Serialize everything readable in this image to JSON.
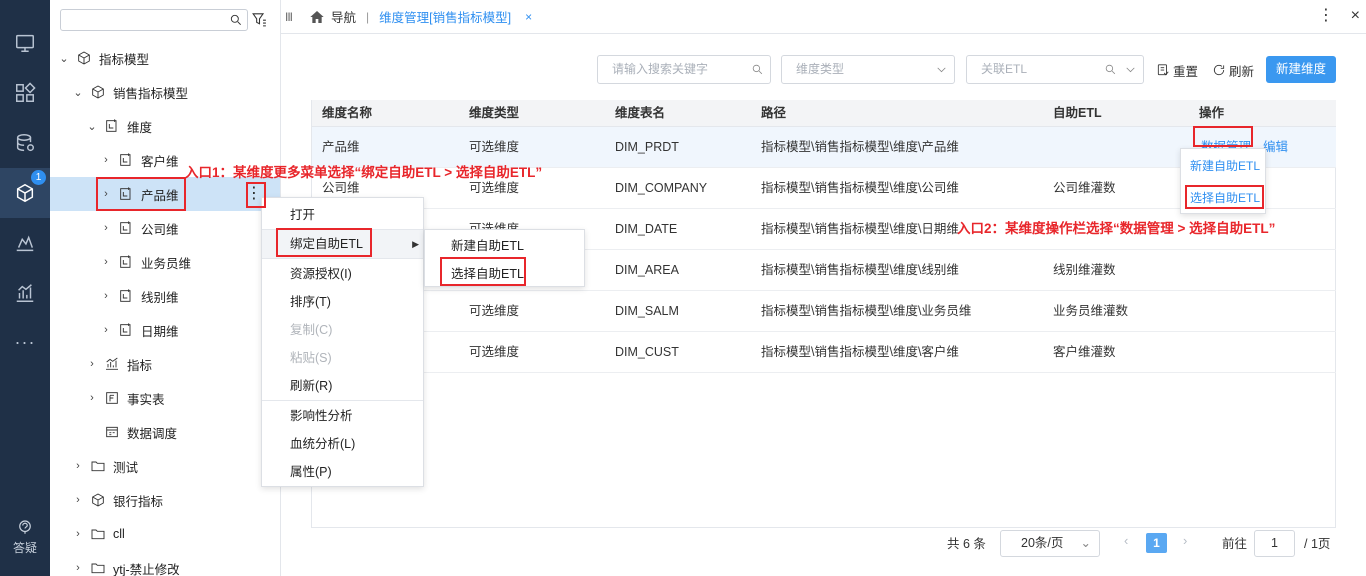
{
  "topbar": {
    "nav_label": "导航",
    "separator": "|",
    "active_tab": "维度管理[销售指标模型]",
    "tab_close": "×",
    "more": "⋮",
    "close": "×"
  },
  "rail": {
    "badge": "1",
    "more_label": "···",
    "help_label": "答疑",
    "icons": [
      "monitor-icon",
      "apps-icon",
      "database-gear-icon",
      "cube-icon",
      "chart-icon",
      "bar-chart-icon"
    ]
  },
  "tree": {
    "search_placeholder": "",
    "items": [
      {
        "label": "指标模型",
        "arrow": "⌄",
        "icon": "cube-icon"
      },
      {
        "label": "销售指标模型",
        "arrow": "⌄",
        "icon": "cube-icon"
      },
      {
        "label": "维度",
        "arrow": "⌄",
        "icon": "dimension-icon"
      },
      {
        "label": "客户维",
        "arrow": "›",
        "icon": "dimension-icon"
      },
      {
        "label": "产品维",
        "arrow": "›",
        "icon": "dimension-icon"
      },
      {
        "label": "公司维",
        "arrow": "›",
        "icon": "dimension-icon"
      },
      {
        "label": "业务员维",
        "arrow": "›",
        "icon": "dimension-icon"
      },
      {
        "label": "线别维",
        "arrow": "›",
        "icon": "dimension-icon"
      },
      {
        "label": "日期维",
        "arrow": "›",
        "icon": "dimension-icon"
      },
      {
        "label": "指标",
        "arrow": "›",
        "icon": "metric-icon"
      },
      {
        "label": "事实表",
        "arrow": "›",
        "icon": "fact-table-icon"
      },
      {
        "label": "数据调度",
        "arrow": "",
        "icon": "schedule-icon"
      },
      {
        "label": "测试",
        "arrow": "›",
        "icon": "folder-icon"
      },
      {
        "label": "银行指标",
        "arrow": "›",
        "icon": "cube-icon"
      },
      {
        "label": "cll",
        "arrow": "›",
        "icon": "folder-icon"
      },
      {
        "label": "ytj-禁止修改",
        "arrow": "›",
        "icon": "folder-icon"
      }
    ],
    "more": "⋮"
  },
  "filters": {
    "search_placeholder": "请输入搜索关键字",
    "dim_type_placeholder": "维度类型",
    "etl_placeholder": "关联ETL",
    "reset": "重置",
    "refresh": "刷新",
    "new_dimension": "新建维度"
  },
  "table": {
    "headers": [
      "维度名称",
      "维度类型",
      "维度表名",
      "路径",
      "自助ETL",
      "操作"
    ],
    "rows": [
      {
        "name": "产品维",
        "type": "可选维度",
        "table": "DIM_PRDT",
        "path": "指标模型\\销售指标模型\\维度\\产品维",
        "etl": ""
      },
      {
        "name": "公司维",
        "type": "可选维度",
        "table": "DIM_COMPANY",
        "path": "指标模型\\销售指标模型\\维度\\公司维",
        "etl": "公司维灌数"
      },
      {
        "name": "",
        "type": "可选维度",
        "table": "DIM_DATE",
        "path": "指标模型\\销售指标模型\\维度\\日期维",
        "etl": ""
      },
      {
        "name": "",
        "type": "",
        "table": "DIM_AREA",
        "path": "指标模型\\销售指标模型\\维度\\线别维",
        "etl": "线别维灌数"
      },
      {
        "name": "",
        "type": "可选维度",
        "table": "DIM_SALM",
        "path": "指标模型\\销售指标模型\\维度\\业务员维",
        "etl": "业务员维灌数"
      },
      {
        "name": "",
        "type": "可选维度",
        "table": "DIM_CUST",
        "path": "指标模型\\销售指标模型\\维度\\客户维",
        "etl": "客户维灌数"
      }
    ],
    "action_data_mgmt": "数据管理",
    "action_edit": "编辑"
  },
  "context_menu": {
    "items": [
      "打开",
      "绑定自助ETL",
      "资源授权(I)",
      "排序(T)",
      "复制(C)",
      "粘贴(S)",
      "刷新(R)",
      "影响性分析",
      "血统分析(L)",
      "属性(P)"
    ],
    "sub_arrow": "▶"
  },
  "submenu": {
    "items": [
      "新建自助ETL",
      "选择自助ETL"
    ]
  },
  "action_dropdown": {
    "items": [
      "新建自助ETL",
      "选择自助ETL"
    ]
  },
  "annotations": {
    "entry1": "入口1：某维度更多菜单选择“绑定自助ETL > 选择自助ETL”",
    "entry2": "入口2：某维度操作栏选择“数据管理 >  选择自助ETL”",
    "color": "#e8262b"
  },
  "pagination": {
    "total": "共 6 条",
    "page_size": "20条/页",
    "prev": "‹",
    "current": "1",
    "next": "›",
    "goto_label": "前往",
    "goto_value": "1",
    "total_pages": "/ 1页"
  },
  "colors": {
    "accent": "#2f8ff0",
    "rail": "#1f3047",
    "selected": "#cde3f7"
  }
}
